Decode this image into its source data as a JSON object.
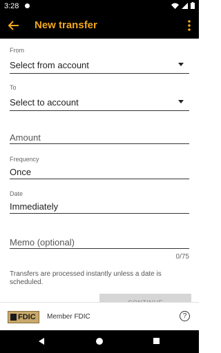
{
  "status": {
    "time": "3:28"
  },
  "app_bar": {
    "title": "New transfer",
    "back_icon": "arrow-left-icon",
    "menu_icon": "more-vert-icon",
    "accent": "#f2a81d"
  },
  "from": {
    "label": "From",
    "value": "Select from account"
  },
  "to": {
    "label": "To",
    "value": "Select to account"
  },
  "amount": {
    "placeholder": "Amount"
  },
  "frequency": {
    "label": "Frequency",
    "value": "Once"
  },
  "date": {
    "label": "Date",
    "value": "Immediately"
  },
  "memo": {
    "placeholder": "Memo (optional)",
    "counter": "0/75"
  },
  "info_text": "Transfers are processed instantly unless a date is scheduled.",
  "continue_label": "CONTINUE",
  "footer": {
    "logo_text": "FDIC",
    "member_text": "Member FDIC",
    "help_glyph": "?"
  }
}
